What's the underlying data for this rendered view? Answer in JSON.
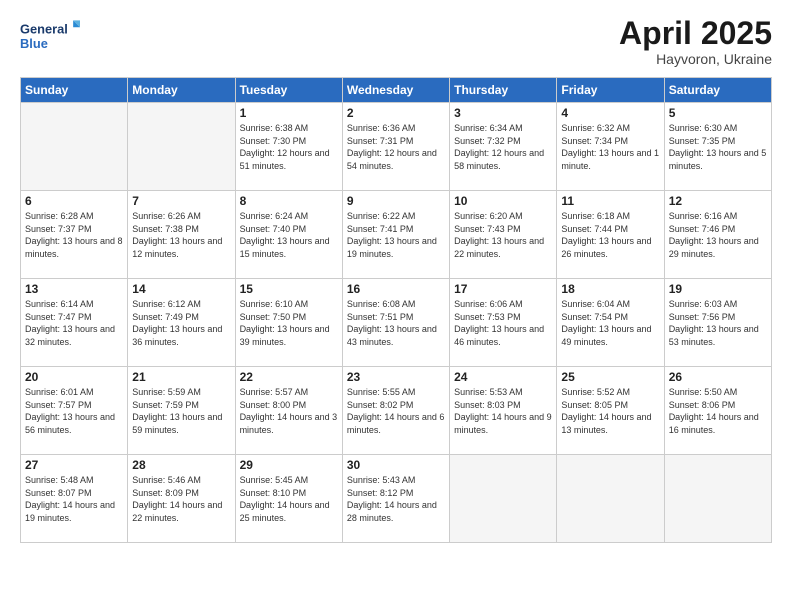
{
  "logo": {
    "line1": "General",
    "line2": "Blue"
  },
  "title": {
    "month": "April 2025",
    "location": "Hayvoron, Ukraine"
  },
  "weekdays": [
    "Sunday",
    "Monday",
    "Tuesday",
    "Wednesday",
    "Thursday",
    "Friday",
    "Saturday"
  ],
  "weeks": [
    [
      {
        "day": "",
        "info": ""
      },
      {
        "day": "",
        "info": ""
      },
      {
        "day": "1",
        "info": "Sunrise: 6:38 AM\nSunset: 7:30 PM\nDaylight: 12 hours and 51 minutes."
      },
      {
        "day": "2",
        "info": "Sunrise: 6:36 AM\nSunset: 7:31 PM\nDaylight: 12 hours and 54 minutes."
      },
      {
        "day": "3",
        "info": "Sunrise: 6:34 AM\nSunset: 7:32 PM\nDaylight: 12 hours and 58 minutes."
      },
      {
        "day": "4",
        "info": "Sunrise: 6:32 AM\nSunset: 7:34 PM\nDaylight: 13 hours and 1 minute."
      },
      {
        "day": "5",
        "info": "Sunrise: 6:30 AM\nSunset: 7:35 PM\nDaylight: 13 hours and 5 minutes."
      }
    ],
    [
      {
        "day": "6",
        "info": "Sunrise: 6:28 AM\nSunset: 7:37 PM\nDaylight: 13 hours and 8 minutes."
      },
      {
        "day": "7",
        "info": "Sunrise: 6:26 AM\nSunset: 7:38 PM\nDaylight: 13 hours and 12 minutes."
      },
      {
        "day": "8",
        "info": "Sunrise: 6:24 AM\nSunset: 7:40 PM\nDaylight: 13 hours and 15 minutes."
      },
      {
        "day": "9",
        "info": "Sunrise: 6:22 AM\nSunset: 7:41 PM\nDaylight: 13 hours and 19 minutes."
      },
      {
        "day": "10",
        "info": "Sunrise: 6:20 AM\nSunset: 7:43 PM\nDaylight: 13 hours and 22 minutes."
      },
      {
        "day": "11",
        "info": "Sunrise: 6:18 AM\nSunset: 7:44 PM\nDaylight: 13 hours and 26 minutes."
      },
      {
        "day": "12",
        "info": "Sunrise: 6:16 AM\nSunset: 7:46 PM\nDaylight: 13 hours and 29 minutes."
      }
    ],
    [
      {
        "day": "13",
        "info": "Sunrise: 6:14 AM\nSunset: 7:47 PM\nDaylight: 13 hours and 32 minutes."
      },
      {
        "day": "14",
        "info": "Sunrise: 6:12 AM\nSunset: 7:49 PM\nDaylight: 13 hours and 36 minutes."
      },
      {
        "day": "15",
        "info": "Sunrise: 6:10 AM\nSunset: 7:50 PM\nDaylight: 13 hours and 39 minutes."
      },
      {
        "day": "16",
        "info": "Sunrise: 6:08 AM\nSunset: 7:51 PM\nDaylight: 13 hours and 43 minutes."
      },
      {
        "day": "17",
        "info": "Sunrise: 6:06 AM\nSunset: 7:53 PM\nDaylight: 13 hours and 46 minutes."
      },
      {
        "day": "18",
        "info": "Sunrise: 6:04 AM\nSunset: 7:54 PM\nDaylight: 13 hours and 49 minutes."
      },
      {
        "day": "19",
        "info": "Sunrise: 6:03 AM\nSunset: 7:56 PM\nDaylight: 13 hours and 53 minutes."
      }
    ],
    [
      {
        "day": "20",
        "info": "Sunrise: 6:01 AM\nSunset: 7:57 PM\nDaylight: 13 hours and 56 minutes."
      },
      {
        "day": "21",
        "info": "Sunrise: 5:59 AM\nSunset: 7:59 PM\nDaylight: 13 hours and 59 minutes."
      },
      {
        "day": "22",
        "info": "Sunrise: 5:57 AM\nSunset: 8:00 PM\nDaylight: 14 hours and 3 minutes."
      },
      {
        "day": "23",
        "info": "Sunrise: 5:55 AM\nSunset: 8:02 PM\nDaylight: 14 hours and 6 minutes."
      },
      {
        "day": "24",
        "info": "Sunrise: 5:53 AM\nSunset: 8:03 PM\nDaylight: 14 hours and 9 minutes."
      },
      {
        "day": "25",
        "info": "Sunrise: 5:52 AM\nSunset: 8:05 PM\nDaylight: 14 hours and 13 minutes."
      },
      {
        "day": "26",
        "info": "Sunrise: 5:50 AM\nSunset: 8:06 PM\nDaylight: 14 hours and 16 minutes."
      }
    ],
    [
      {
        "day": "27",
        "info": "Sunrise: 5:48 AM\nSunset: 8:07 PM\nDaylight: 14 hours and 19 minutes."
      },
      {
        "day": "28",
        "info": "Sunrise: 5:46 AM\nSunset: 8:09 PM\nDaylight: 14 hours and 22 minutes."
      },
      {
        "day": "29",
        "info": "Sunrise: 5:45 AM\nSunset: 8:10 PM\nDaylight: 14 hours and 25 minutes."
      },
      {
        "day": "30",
        "info": "Sunrise: 5:43 AM\nSunset: 8:12 PM\nDaylight: 14 hours and 28 minutes."
      },
      {
        "day": "",
        "info": ""
      },
      {
        "day": "",
        "info": ""
      },
      {
        "day": "",
        "info": ""
      }
    ]
  ]
}
